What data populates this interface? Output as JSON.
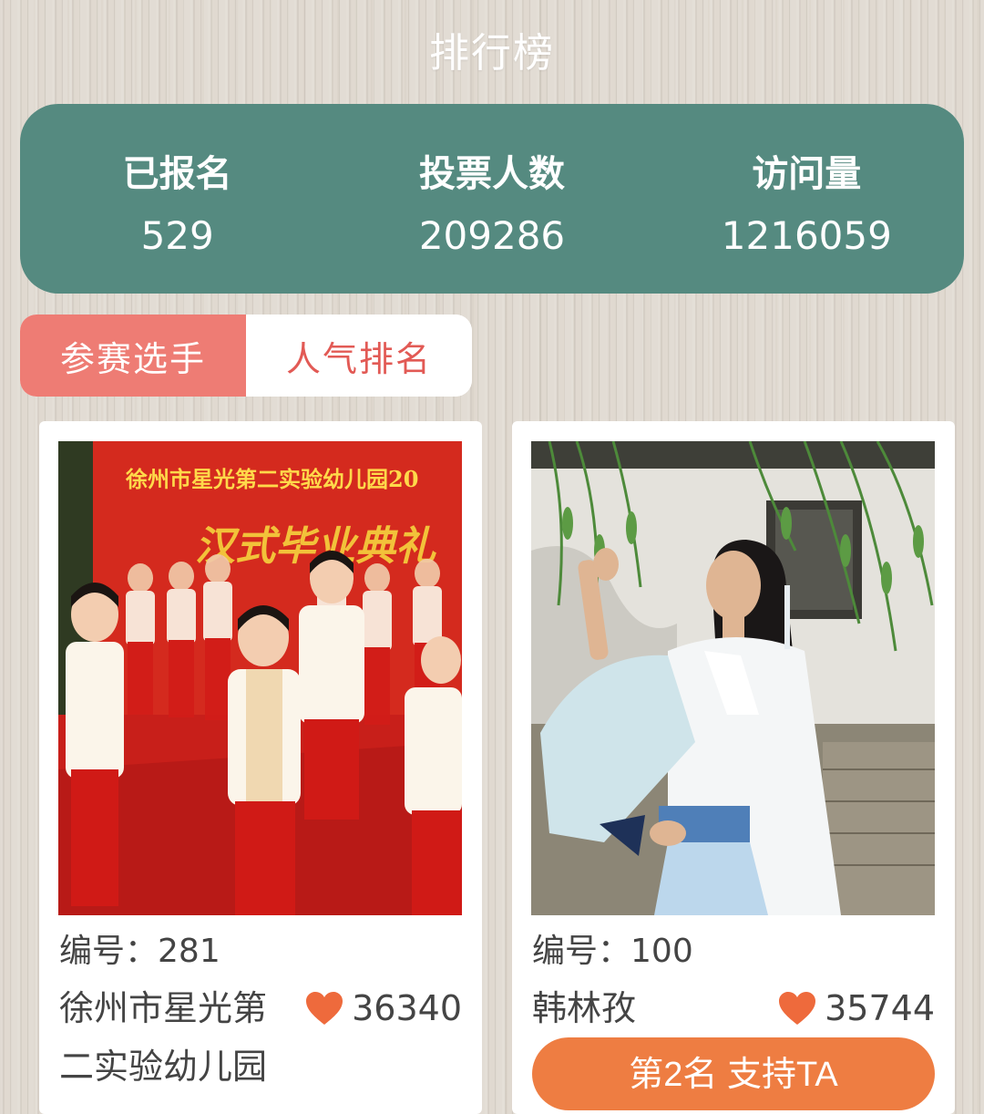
{
  "header": {
    "title": "排行榜"
  },
  "stats": [
    {
      "label": "已报名",
      "value": "529"
    },
    {
      "label": "投票人数",
      "value": "209286"
    },
    {
      "label": "访问量",
      "value": "1216059"
    }
  ],
  "tabs": [
    {
      "label": "参赛选手",
      "active": true
    },
    {
      "label": "人气排名",
      "active": false
    }
  ],
  "cards": [
    {
      "number_label": "编号：",
      "number": "281",
      "name": "徐州市星光第二实验幼儿园",
      "votes": "36340",
      "photo_banner_text": "徐州市星光第二实验幼儿园20",
      "photo_subtitle_text": "汉式毕业典礼"
    },
    {
      "number_label": "编号：",
      "number": "100",
      "name": "韩林孜",
      "votes": "35744",
      "button_label": "第2名 支持TA"
    }
  ],
  "colors": {
    "stats_bg": "#558a80",
    "tab_active_bg": "#ee7c74",
    "tab_inactive_text": "#e25a55",
    "button_bg": "#ee7d42",
    "heart": "#ee6a3c"
  },
  "icons": {
    "vote": "heart-icon"
  }
}
